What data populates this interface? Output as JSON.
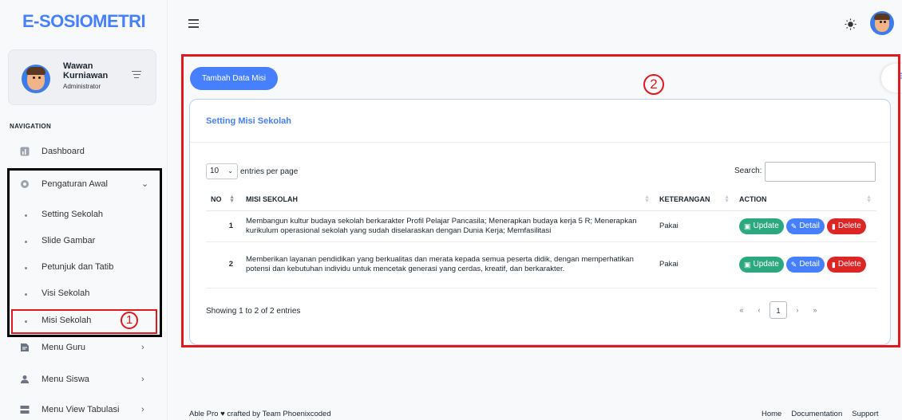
{
  "app": {
    "logo": "E-SOSIOMETRI",
    "user": {
      "name": "Wawan Kurniawan",
      "role": "Administrator"
    }
  },
  "sidebar": {
    "caption": "NAVIGATION",
    "items": [
      {
        "label": "Dashboard",
        "icon": "dashboard-icon"
      },
      {
        "label": "Pengaturan Awal",
        "icon": "gear-icon",
        "expanded": true,
        "children": [
          "Setting Sekolah",
          "Slide Gambar",
          "Petunjuk dan Tatib",
          "Visi Sekolah",
          "Misi Sekolah"
        ]
      },
      {
        "label": "Menu Guru",
        "icon": "teacher-icon"
      },
      {
        "label": "Menu Siswa",
        "icon": "students-icon"
      },
      {
        "label": "Menu View Tabulasi",
        "icon": "table-icon"
      }
    ]
  },
  "annotations": {
    "marker1": "1",
    "marker2": "2"
  },
  "main": {
    "add_button": "Tambah Data Misi",
    "card_title": "Setting Misi Sekolah",
    "entries_value": "10",
    "entries_label": "entries per page",
    "search_label": "Search:",
    "columns": [
      "NO",
      "MISI SEKOLAH",
      "KETERANGAN",
      "ACTION"
    ],
    "rows": [
      {
        "no": "1",
        "misi": "Membangun kultur budaya sekolah berkarakter Profil Pelajar Pancasila; Menerapkan budaya kerja 5 R; Menerapkan kurikulum operasional sekolah yang sudah diselaraskan dengan Dunia Kerja; Memfasilitasi",
        "keterangan": "Pakai"
      },
      {
        "no": "2",
        "misi": "Memberikan layanan pendidikan yang berkualitas dan merata kepada semua peserta didik, dengan memperhatikan potensi dan kebutuhan individu untuk mencetak generasi yang cerdas, kreatif, dan berkarakter.",
        "keterangan": "Pakai"
      }
    ],
    "action_labels": {
      "update": "Update",
      "detail": "Detail",
      "delete": "Delete"
    },
    "showing": "Showing 1 to 2 of 2 entries",
    "pager": {
      "first": "«",
      "prev": "‹",
      "current": "1",
      "next": "›",
      "last": "»"
    }
  },
  "footer": {
    "credit": "Able Pro ♥ crafted by Team Phoenixcoded",
    "links": [
      "Home",
      "Documentation",
      "Support"
    ]
  },
  "colors": {
    "primary": "#4680ff",
    "success": "#2ca87f",
    "danger": "#dc2626",
    "annotation": "#e0191f"
  }
}
